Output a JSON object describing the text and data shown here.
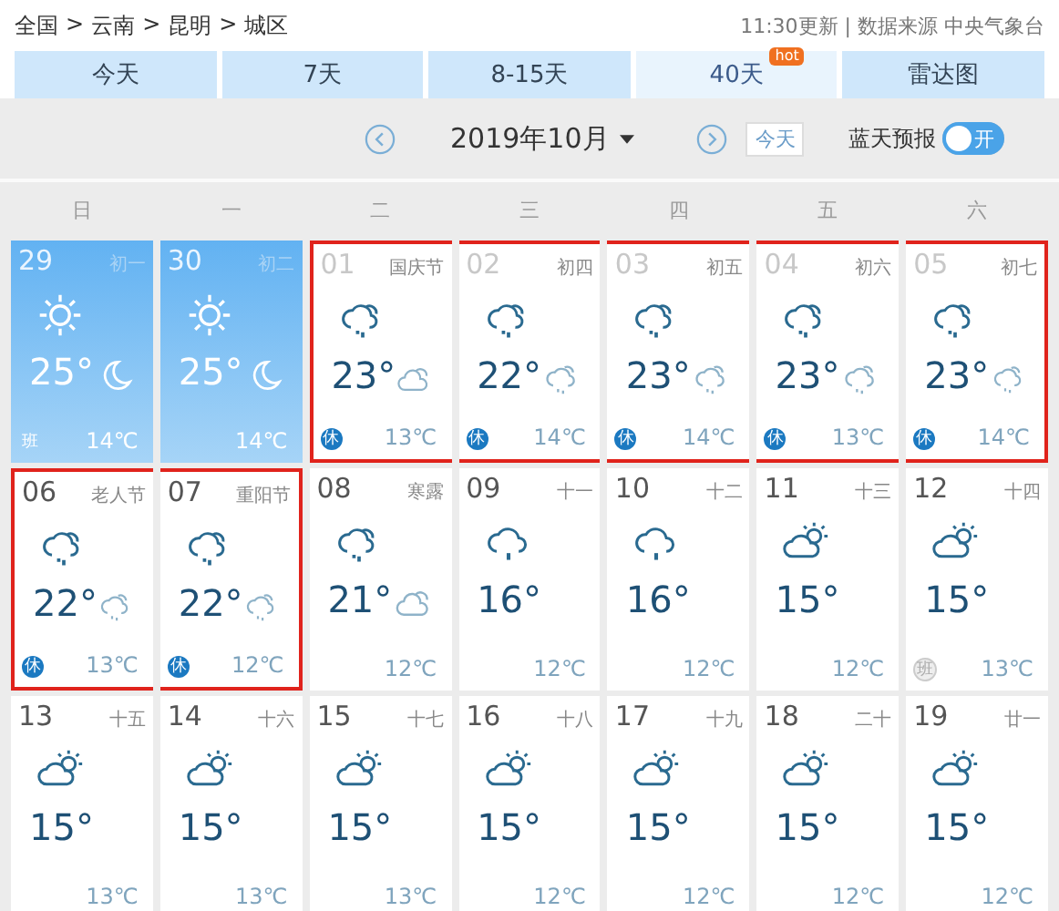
{
  "breadcrumb": [
    "全国",
    ">",
    "云南",
    ">",
    "昆明",
    ">",
    "城区"
  ],
  "update_info": "11:30更新 | 数据来源 中央气象台",
  "tabs": [
    {
      "label": "今天",
      "selected": false
    },
    {
      "label": "7天",
      "selected": false
    },
    {
      "label": "8-15天",
      "selected": false
    },
    {
      "label": "40天",
      "selected": true,
      "badge": "hot"
    },
    {
      "label": "雷达图",
      "selected": false
    }
  ],
  "month": "2019年10月",
  "today_button": "今天",
  "toggle": {
    "label": "蓝天预报",
    "text": "开",
    "on": true
  },
  "weekdays": [
    "日",
    "一",
    "二",
    "三",
    "四",
    "五",
    "六"
  ],
  "days": [
    {
      "kind": "past",
      "date": "29",
      "lunar": "初一",
      "day_icon": {
        "kind": "sun"
      },
      "high": "25°",
      "night_icon": {
        "kind": "moon"
      },
      "low": "14℃",
      "badge": {
        "text": "班",
        "kind": "work"
      },
      "faded": false,
      "highlighted": false
    },
    {
      "kind": "past",
      "date": "30",
      "lunar": "初二",
      "day_icon": {
        "kind": "sun"
      },
      "high": "25°",
      "night_icon": {
        "kind": "moon"
      },
      "low": "14℃",
      "faded": false,
      "highlighted": false
    },
    {
      "kind": "forecast",
      "date": "01",
      "lunar": "国庆节",
      "day_icon": {
        "kind": "showers"
      },
      "high": "23°",
      "night_icon": {
        "kind": "cloudy"
      },
      "low": "13℃",
      "badge": {
        "text": "休",
        "kind": "rest"
      },
      "faded": true,
      "highlighted": true
    },
    {
      "kind": "forecast",
      "date": "02",
      "lunar": "初四",
      "day_icon": {
        "kind": "showers"
      },
      "high": "22°",
      "night_icon": {
        "kind": "showers"
      },
      "low": "14℃",
      "badge": {
        "text": "休",
        "kind": "rest"
      },
      "faded": true,
      "highlighted": true
    },
    {
      "kind": "forecast",
      "date": "03",
      "lunar": "初五",
      "day_icon": {
        "kind": "showers"
      },
      "high": "23°",
      "night_icon": {
        "kind": "showers"
      },
      "low": "14℃",
      "badge": {
        "text": "休",
        "kind": "rest"
      },
      "faded": true,
      "highlighted": true
    },
    {
      "kind": "forecast",
      "date": "04",
      "lunar": "初六",
      "day_icon": {
        "kind": "showers"
      },
      "high": "23°",
      "night_icon": {
        "kind": "showers"
      },
      "low": "13℃",
      "badge": {
        "text": "休",
        "kind": "rest"
      },
      "faded": true,
      "highlighted": true
    },
    {
      "kind": "forecast",
      "date": "05",
      "lunar": "初七",
      "day_icon": {
        "kind": "showers"
      },
      "high": "23°",
      "night_icon": {
        "kind": "showers"
      },
      "low": "14℃",
      "badge": {
        "text": "休",
        "kind": "rest"
      },
      "faded": true,
      "highlighted": true
    },
    {
      "kind": "forecast",
      "date": "06",
      "lunar": "老人节",
      "day_icon": {
        "kind": "showers"
      },
      "high": "22°",
      "night_icon": {
        "kind": "showers"
      },
      "low": "13℃",
      "badge": {
        "text": "休",
        "kind": "rest"
      },
      "faded": false,
      "highlighted": true
    },
    {
      "kind": "forecast",
      "date": "07",
      "lunar": "重阳节",
      "day_icon": {
        "kind": "showers"
      },
      "high": "22°",
      "night_icon": {
        "kind": "showers"
      },
      "low": "12℃",
      "badge": {
        "text": "休",
        "kind": "rest"
      },
      "faded": false,
      "highlighted": true
    },
    {
      "kind": "forecast",
      "date": "08",
      "lunar": "寒露",
      "day_icon": {
        "kind": "showers"
      },
      "high": "21°",
      "night_icon": {
        "kind": "cloudy"
      },
      "low": "12℃",
      "faded": false,
      "highlighted": false
    },
    {
      "kind": "forecast",
      "date": "09",
      "lunar": "十一",
      "day_icon": {
        "kind": "rain"
      },
      "high": "16°",
      "low": "12℃",
      "faded": false,
      "highlighted": false
    },
    {
      "kind": "forecast",
      "date": "10",
      "lunar": "十二",
      "day_icon": {
        "kind": "rain"
      },
      "high": "16°",
      "low": "12℃",
      "faded": false,
      "highlighted": false
    },
    {
      "kind": "forecast",
      "date": "11",
      "lunar": "十三",
      "day_icon": {
        "kind": "cloudy"
      },
      "high": "15°",
      "low": "12℃",
      "faded": false,
      "highlighted": false
    },
    {
      "kind": "forecast",
      "date": "12",
      "lunar": "十四",
      "day_icon": {
        "kind": "cloudy"
      },
      "high": "15°",
      "low": "13℃",
      "badge": {
        "text": "班",
        "kind": "work"
      },
      "faded": false,
      "highlighted": false
    },
    {
      "kind": "forecast",
      "date": "13",
      "lunar": "十五",
      "day_icon": {
        "kind": "cloudy"
      },
      "high": "15°",
      "low": "13℃",
      "faded": false,
      "highlighted": false
    },
    {
      "kind": "forecast",
      "date": "14",
      "lunar": "十六",
      "day_icon": {
        "kind": "cloudy"
      },
      "high": "15°",
      "low": "13℃",
      "faded": false,
      "highlighted": false
    },
    {
      "kind": "forecast",
      "date": "15",
      "lunar": "十七",
      "day_icon": {
        "kind": "cloudy"
      },
      "high": "15°",
      "low": "13℃",
      "faded": false,
      "highlighted": false
    },
    {
      "kind": "forecast",
      "date": "16",
      "lunar": "十八",
      "day_icon": {
        "kind": "cloudy"
      },
      "high": "15°",
      "low": "12℃",
      "faded": false,
      "highlighted": false
    },
    {
      "kind": "forecast",
      "date": "17",
      "lunar": "十九",
      "day_icon": {
        "kind": "cloudy"
      },
      "high": "15°",
      "low": "12℃",
      "faded": false,
      "highlighted": false
    },
    {
      "kind": "forecast",
      "date": "18",
      "lunar": "二十",
      "day_icon": {
        "kind": "cloudy"
      },
      "high": "15°",
      "low": "12℃",
      "faded": false,
      "highlighted": false
    },
    {
      "kind": "forecast",
      "date": "19",
      "lunar": "廿一",
      "day_icon": {
        "kind": "cloudy"
      },
      "high": "15°",
      "low": "12℃",
      "faded": false,
      "highlighted": false
    }
  ]
}
